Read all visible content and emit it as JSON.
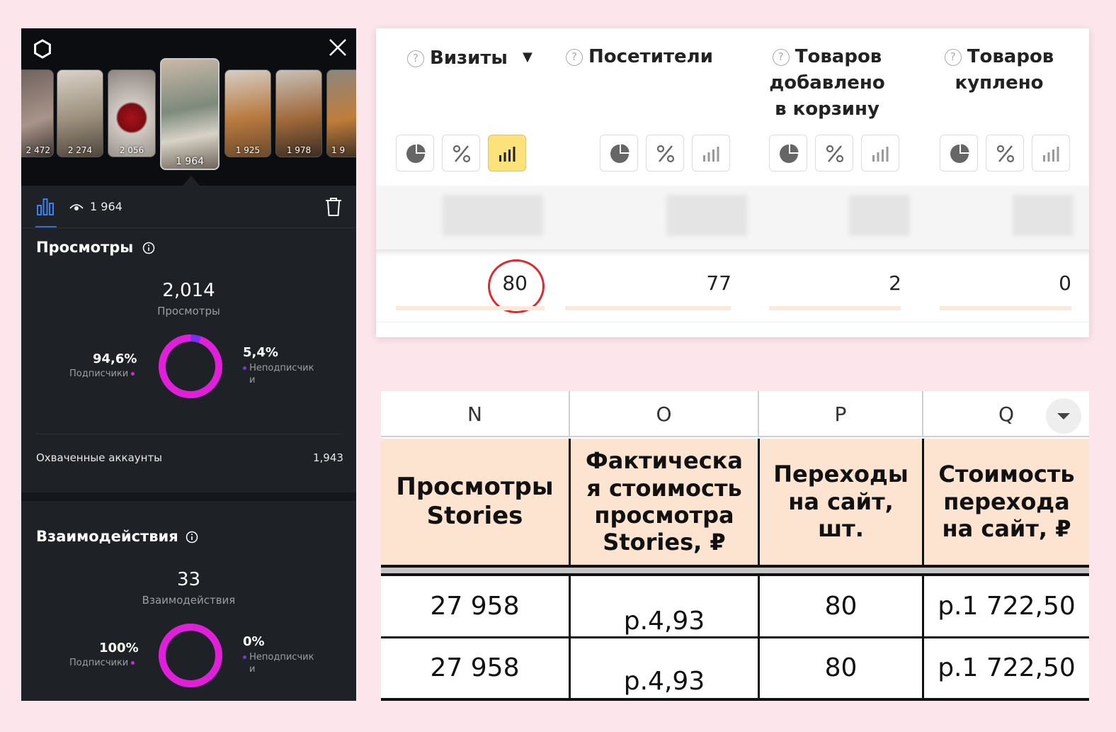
{
  "colors": {
    "page_bg": "#fce6ec",
    "accent_magenta": "#e01fd8",
    "accent_purple": "#7b2ff0",
    "active_btn": "#fde27c",
    "header_fill": "#fce4d0",
    "circle_mark": "#e0282e"
  },
  "stories": {
    "thumbnails": [
      {
        "count": "2 472"
      },
      {
        "count": "2 274"
      },
      {
        "count": "2 056"
      },
      {
        "count": "1 964",
        "selected": true
      },
      {
        "count": "1 925"
      },
      {
        "count": "1 978"
      },
      {
        "count": "1 9"
      }
    ],
    "toolbar_count": "1 964",
    "views": {
      "title": "Просмотры",
      "total": "2,014",
      "total_label": "Просмотры",
      "subscribers_pct": "94,6%",
      "subscribers_label": "Подписчики",
      "subscribers_share": 0.946,
      "non_subscribers_pct": "5,4%",
      "non_subscribers_label_1": "Неподписчик",
      "non_subscribers_label_2": "и"
    },
    "reach": {
      "label": "Охваченные аккаунты",
      "value": "1,943"
    },
    "interactions": {
      "title": "Взаимодействия",
      "total": "33",
      "total_label": "Взаимодействия",
      "subscribers_pct": "100%",
      "subscribers_label": "Подписчики",
      "subscribers_share": 1.0,
      "non_subscribers_pct": "0%",
      "non_subscribers_label_1": "Неподписчик",
      "non_subscribers_label_2": "и"
    }
  },
  "metrics": {
    "columns": [
      {
        "lines": [
          "Визиты"
        ],
        "sort_arrow": "▼",
        "value": "80",
        "active_view": "bars"
      },
      {
        "lines": [
          "Посетители"
        ],
        "value": "77"
      },
      {
        "lines": [
          "Товаров",
          "добавлено",
          "в корзину"
        ],
        "value": "2"
      },
      {
        "lines": [
          "Товаров",
          "куплено"
        ],
        "value": "0"
      }
    ],
    "highlighted_value": "80"
  },
  "sheet": {
    "column_letters": [
      "N",
      "O",
      "P",
      "Q"
    ],
    "headers": [
      [
        "Просмотры",
        "Stories"
      ],
      [
        "Фактическа",
        "я стоимость",
        "просмотра",
        "Stories, ₽"
      ],
      [
        "Переходы",
        "на сайт,",
        "шт."
      ],
      [
        "Стоимость",
        "перехода",
        "на сайт, ₽"
      ]
    ],
    "rows": [
      [
        "27 958",
        "р.4,93",
        "80",
        "р.1 722,50"
      ],
      [
        "27 958",
        "р.4,93",
        "80",
        "р.1 722,50"
      ]
    ]
  }
}
